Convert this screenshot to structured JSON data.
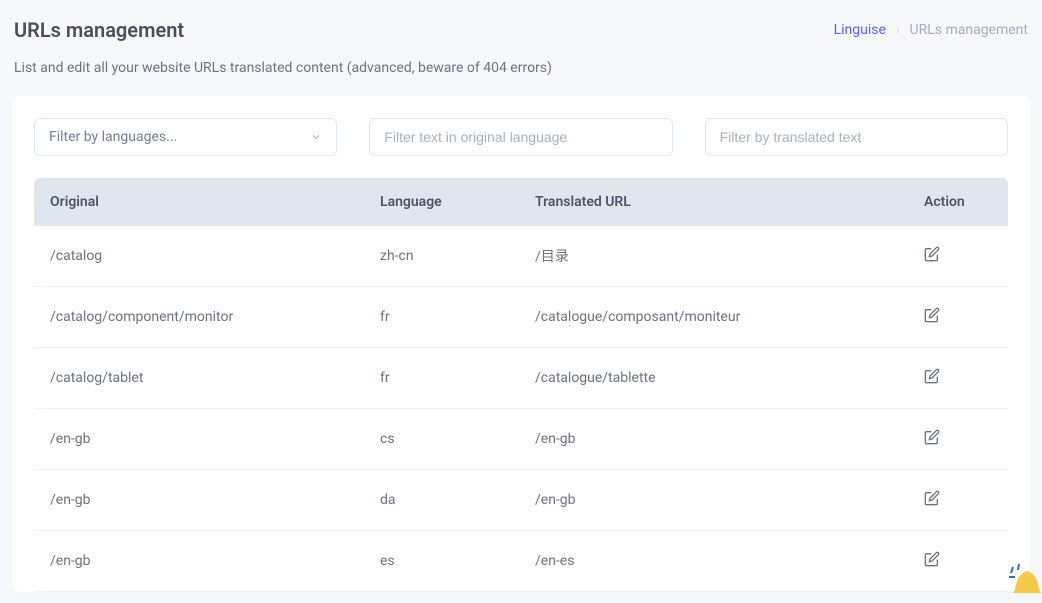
{
  "header": {
    "title": "URLs management",
    "breadcrumb": {
      "root": "Linguise",
      "current": "URLs management"
    },
    "subtitle": "List and edit all your website URLs translated content (advanced, beware of 404 errors)"
  },
  "filters": {
    "language_placeholder": "Filter by languages...",
    "original_placeholder": "Filter text in original language",
    "translated_placeholder": "Filter by translated text"
  },
  "table": {
    "headers": {
      "original": "Original",
      "language": "Language",
      "translated": "Translated URL",
      "action": "Action"
    },
    "rows": [
      {
        "original": "/catalog",
        "language": "zh-cn",
        "translated": "/目录"
      },
      {
        "original": "/catalog/component/monitor",
        "language": "fr",
        "translated": "/catalogue/composant/moniteur"
      },
      {
        "original": "/catalog/tablet",
        "language": "fr",
        "translated": "/catalogue/tablette"
      },
      {
        "original": "/en-gb",
        "language": "cs",
        "translated": "/en-gb"
      },
      {
        "original": "/en-gb",
        "language": "da",
        "translated": "/en-gb"
      },
      {
        "original": "/en-gb",
        "language": "es",
        "translated": "/en-es"
      }
    ]
  }
}
